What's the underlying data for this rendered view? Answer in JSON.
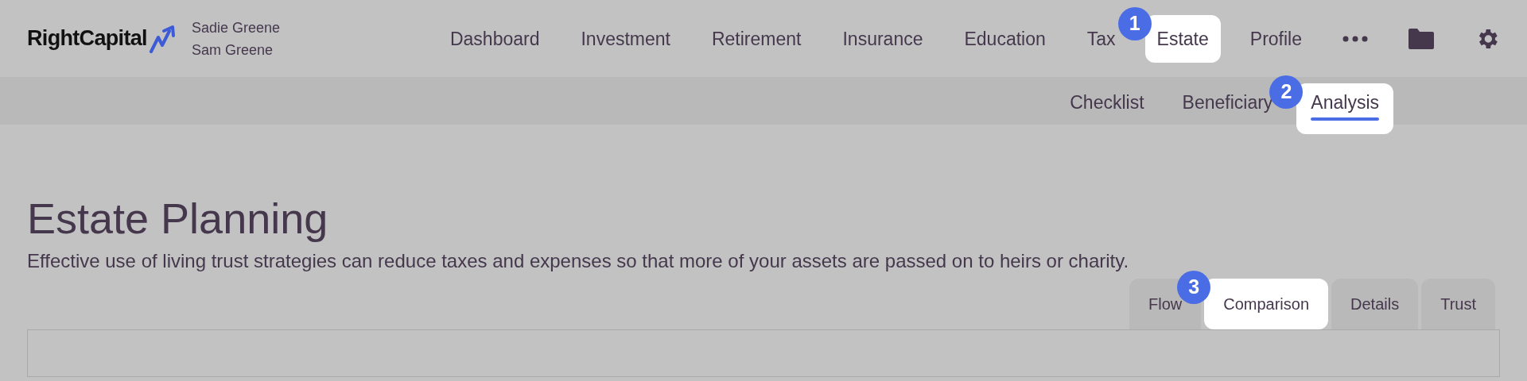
{
  "header": {
    "logo": "RightCapital",
    "clients": [
      "Sadie Greene",
      "Sam Greene"
    ]
  },
  "nav": [
    {
      "label": "Dashboard",
      "selected": false
    },
    {
      "label": "Investment",
      "selected": false
    },
    {
      "label": "Retirement",
      "selected": false
    },
    {
      "label": "Insurance",
      "selected": false
    },
    {
      "label": "Education",
      "selected": false
    },
    {
      "label": "Tax",
      "selected": false
    },
    {
      "label": "Estate",
      "selected": true,
      "step": "1"
    },
    {
      "label": "Profile",
      "selected": false
    }
  ],
  "subnav": [
    {
      "label": "Checklist",
      "selected": false
    },
    {
      "label": "Beneficiary",
      "selected": false
    },
    {
      "label": "Analysis",
      "selected": true,
      "step": "2"
    }
  ],
  "page": {
    "title": "Estate Planning",
    "description": "Effective use of living trust strategies can reduce taxes and expenses so that more of your assets are passed on to heirs or charity."
  },
  "tabs": [
    {
      "label": "Flow",
      "selected": false
    },
    {
      "label": "Comparison",
      "selected": true,
      "step": "3"
    },
    {
      "label": "Details",
      "selected": false
    },
    {
      "label": "Trust",
      "selected": false
    }
  ]
}
